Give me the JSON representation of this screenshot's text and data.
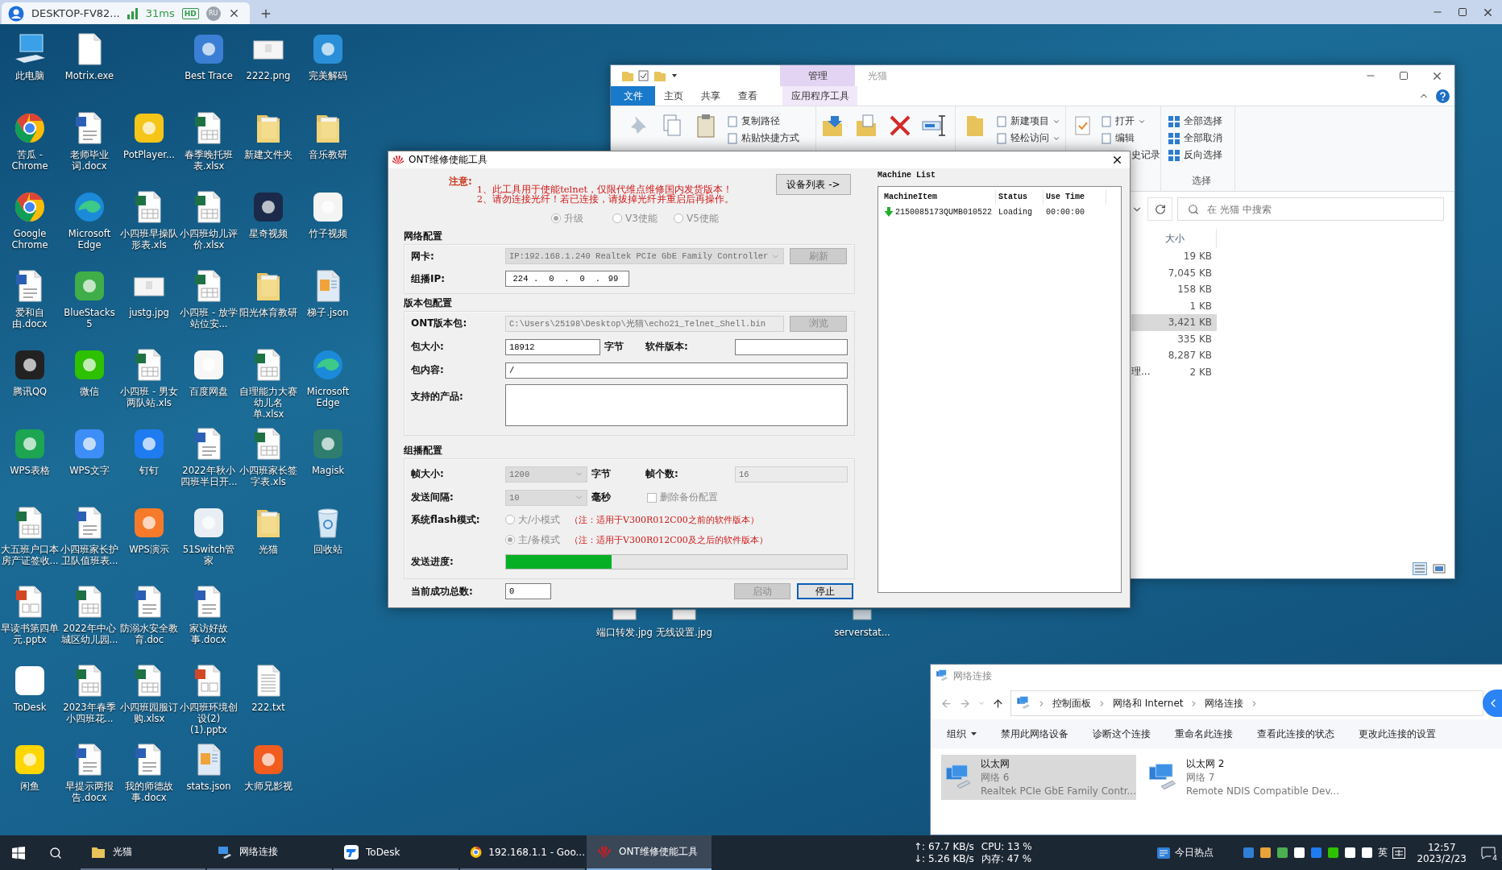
{
  "remote_tab": {
    "title": "DESKTOP-FV82...",
    "latency": "31ms",
    "quality": "HD",
    "user": "RU"
  },
  "desktop_icon_rows": [
    [
      {
        "label": "此电脑",
        "kind": "pc"
      },
      {
        "label": "Motrix.exe",
        "kind": "file"
      },
      null,
      {
        "label": "Best Trace",
        "kind": "app",
        "color": "#3b7fd4"
      },
      {
        "label": "2222.png",
        "kind": "image"
      },
      {
        "label": "完美解码",
        "kind": "app",
        "color": "#2a8fd8"
      }
    ],
    [
      {
        "label": "苦瓜 - Chrome",
        "kind": "chrome"
      },
      {
        "label": "老师毕业词.docx",
        "kind": "word"
      },
      {
        "label": "PotPlayer...",
        "kind": "app",
        "color": "#f5c518"
      },
      {
        "label": "春季晚托班表.xlsx",
        "kind": "excel"
      },
      {
        "label": "新建文件夹",
        "kind": "folder"
      },
      {
        "label": "音乐教研",
        "kind": "folder"
      }
    ],
    [
      {
        "label": "Google Chrome",
        "kind": "chrome"
      },
      {
        "label": "Microsoft Edge",
        "kind": "edge"
      },
      {
        "label": "小四班早操队形表.xls",
        "kind": "excel"
      },
      {
        "label": "小四班幼儿评价.xlsx",
        "kind": "excel"
      },
      {
        "label": "星奇视频",
        "kind": "app",
        "color": "#1b2a4a"
      },
      {
        "label": "竹子视频",
        "kind": "app",
        "color": "#f4f4f4"
      }
    ],
    [
      {
        "label": "爱和自由.docx",
        "kind": "word"
      },
      {
        "label": "BlueStacks 5",
        "kind": "app",
        "color": "#3fae49"
      },
      {
        "label": "justg.jpg",
        "kind": "image"
      },
      {
        "label": "小四班 - 放学站位安...",
        "kind": "excel"
      },
      {
        "label": "阳光体育教研",
        "kind": "folder"
      },
      {
        "label": "梯子.json",
        "kind": "json"
      }
    ],
    [
      {
        "label": "腾讯QQ",
        "kind": "app",
        "color": "#222222"
      },
      {
        "label": "微信",
        "kind": "app",
        "color": "#2dc100"
      },
      {
        "label": "小四班 - 男女两队站.xls",
        "kind": "excel"
      },
      {
        "label": "百度网盘",
        "kind": "app",
        "color": "#f7f7f7"
      },
      {
        "label": "自理能力大赛幼儿名单.xlsx",
        "kind": "excel"
      },
      {
        "label": "Microsoft Edge",
        "kind": "edge"
      }
    ],
    [
      {
        "label": "WPS表格",
        "kind": "app",
        "color": "#1da552"
      },
      {
        "label": "WPS文字",
        "kind": "app",
        "color": "#3d8ef7"
      },
      {
        "label": "钉钉",
        "kind": "app",
        "color": "#1f7cf0"
      },
      {
        "label": "2022年秋小四班半日开...",
        "kind": "word"
      },
      {
        "label": "小四班家长签字表.xls",
        "kind": "excel"
      },
      {
        "label": "Magisk",
        "kind": "app",
        "color": "#2f7d6e"
      }
    ],
    [
      {
        "label": "大五班户口本房产证签收...",
        "kind": "excel"
      },
      {
        "label": "小四班家长护卫队值班表...",
        "kind": "word"
      },
      {
        "label": "WPS演示",
        "kind": "app",
        "color": "#f77a2a"
      },
      {
        "label": "51Switch管家",
        "kind": "app",
        "color": "#e9eef5"
      },
      {
        "label": "光猫",
        "kind": "folder"
      },
      {
        "label": "回收站",
        "kind": "recycle"
      }
    ],
    [
      {
        "label": "早读书第四单元.pptx",
        "kind": "ppt"
      },
      {
        "label": "2022年中心城区幼儿园...",
        "kind": "excel"
      },
      {
        "label": "防溺水安全教育.doc",
        "kind": "word"
      },
      {
        "label": "家访好故事.docx",
        "kind": "word"
      }
    ],
    [
      {
        "label": "ToDesk",
        "kind": "app",
        "color": "#ffffff"
      },
      {
        "label": "2023年春季小四班花...",
        "kind": "excel"
      },
      {
        "label": "小四班园服订购.xlsx",
        "kind": "excel"
      },
      {
        "label": "小四班环境创设(2)(1).pptx",
        "kind": "ppt"
      },
      {
        "label": "222.txt",
        "kind": "text"
      }
    ],
    [
      {
        "label": "闲鱼",
        "kind": "app",
        "color": "#ffd600"
      },
      {
        "label": "早提示两报告.docx",
        "kind": "word"
      },
      {
        "label": "我的师德故事.docx",
        "kind": "word"
      },
      {
        "label": "stats.json",
        "kind": "json"
      },
      {
        "label": "大师兄影视",
        "kind": "app",
        "color": "#f25c1f"
      }
    ]
  ],
  "desktop_extra_icons": [
    {
      "label": "端口转发.jpg",
      "kind": "image"
    },
    {
      "label": "无线设置.jpg",
      "kind": "image"
    },
    {
      "label": "serverstat...",
      "kind": "file"
    }
  ],
  "explorer": {
    "title": "光猫",
    "context_header": "管理",
    "tabs": [
      {
        "label": "文件",
        "kind": "file"
      },
      {
        "label": "主页",
        "kind": "tab"
      },
      {
        "label": "共享",
        "kind": "tab"
      },
      {
        "label": "查看",
        "kind": "tab"
      },
      {
        "label": "应用程序工具",
        "kind": "context"
      }
    ],
    "clipboard_commands": [
      {
        "label": "复制路径",
        "kind": "icon",
        "dropdown": false
      },
      {
        "label": "粘贴快捷方式",
        "kind": "icon",
        "dropdown": false
      }
    ],
    "new_commands": [
      {
        "label": "新建项目",
        "kind": "icon",
        "dropdown": true
      },
      {
        "label": "轻松访问",
        "kind": "icon",
        "dropdown": true
      }
    ],
    "open_commands": [
      {
        "label": "打开",
        "kind": "icon",
        "dropdown": true
      },
      {
        "label": "编辑",
        "kind": "icon",
        "dropdown": false
      },
      {
        "label": "史记录",
        "kind": "cut",
        "dropdown": false
      }
    ],
    "select_commands": [
      {
        "label": "全部选择",
        "kind": "icon",
        "dropdown": false
      },
      {
        "label": "全部取消",
        "kind": "icon",
        "dropdown": false
      },
      {
        "label": "反向选择",
        "kind": "icon",
        "dropdown": false
      }
    ],
    "select_label": "选择",
    "search_placeholder": "在 光猫 中搜索",
    "size_column": "大小",
    "files": [
      {
        "size": "19 KB",
        "selected": false
      },
      {
        "size": "7,045 KB",
        "selected": false
      },
      {
        "size": "158 KB",
        "selected": false
      },
      {
        "size": "1 KB",
        "selected": false
      },
      {
        "size": "3,421 KB",
        "selected": true
      },
      {
        "size": "335 KB",
        "selected": false
      },
      {
        "size": "8,287 KB",
        "selected": false
      },
      {
        "name": "理...",
        "size": "2 KB",
        "selected": false
      }
    ]
  },
  "ont_tool": {
    "title": "ONT维修使能工具",
    "notice_label": "注意:",
    "notice_lines": [
      "1、此工具用于使能telnet，仅限代维点维修国内发货版本！",
      "2、请勿连接光纤！若已连接，请拔掉光纤并重启后再操作。"
    ],
    "device_list_button": "设备列表 ->",
    "modes": [
      {
        "label": "升级",
        "selected": true,
        "disabled": true
      },
      {
        "label": "V3使能",
        "selected": false,
        "disabled": true
      },
      {
        "label": "V5使能",
        "selected": false,
        "disabled": true
      }
    ],
    "network": {
      "title": "网络配置",
      "nic_label": "网卡:",
      "nic_value": "IP:192.168.1.240 Realtek PCIe GbE Family Controller",
      "refresh_button": {
        "label": "刷新",
        "disabled": true
      },
      "ip_label": "组播IP:",
      "ip_parts": [
        "224",
        "0",
        "0",
        "99"
      ],
      "ip_separator": "."
    },
    "package": {
      "title": "版本包配置",
      "file_label": "ONT版本包:",
      "file_value": "C:\\Users\\25198\\Desktop\\光猫\\echo21_Telnet_Shell.bin",
      "browse_button": {
        "label": "浏览",
        "disabled": true
      },
      "size_label": "包大小:",
      "size_value": "18912",
      "size_unit": "字节",
      "version_label": "软件版本:",
      "content_label": "包内容:",
      "content_value": "/",
      "products_label": "支持的产品:"
    },
    "multicast": {
      "title": "组播配置",
      "frame_size_label": "帧大小:",
      "frame_size": "1200",
      "frame_size_unit": "字节",
      "frame_count_label": "帧个数:",
      "frame_count": "16",
      "interval_label": "发送间隔:",
      "interval": "10",
      "interval_unit": "毫秒",
      "delete_backup": {
        "label": "删除备份配置",
        "checked": false
      },
      "flash_label": "系统flash模式:",
      "flash_modes": [
        {
          "label": "大/小模式",
          "note": "（注：适用于V300R012C00之前的软件版本）",
          "selected": false
        },
        {
          "label": "主/备模式",
          "note": "（注：适用于V300R012C00及之后的软件版本）",
          "selected": true
        }
      ],
      "progress_label": "发送进度:",
      "progress": {
        "level": 0.31
      }
    },
    "success_label": "当前成功总数:",
    "success_count": "0",
    "start_button": {
      "label": "启动",
      "disabled": true
    },
    "stop_button": {
      "label": "停止",
      "disabled": false
    },
    "machine_list": {
      "title": "Machine List",
      "columns": [
        "MachineItem",
        "Status",
        "Use Time"
      ],
      "rows": [
        {
          "cells": [
            "2150085173QUMB010522",
            "Loading",
            "00:00:00"
          ]
        }
      ]
    }
  },
  "network_window": {
    "title": "网络连接",
    "breadcrumbs": [
      "控制面板",
      "网络和 Internet",
      "网络连接"
    ],
    "commands": [
      {
        "label": "组织",
        "dropdown": true
      },
      {
        "label": "禁用此网络设备",
        "dropdown": false
      },
      {
        "label": "诊断这个连接",
        "dropdown": false
      },
      {
        "label": "重命名此连接",
        "dropdown": false
      },
      {
        "label": "查看此连接的状态",
        "dropdown": false
      },
      {
        "label": "更改此连接的设置",
        "dropdown": false
      }
    ],
    "connections": [
      {
        "name": "以太网",
        "network": "网络 6",
        "device": "Realtek PCIe GbE Family Contr...",
        "selected": true
      },
      {
        "name": "以太网 2",
        "network": "网络 7",
        "device": "Remote NDIS Compatible Dev...",
        "selected": false
      }
    ]
  },
  "taskbar": {
    "items": [
      {
        "label": "光猫",
        "kind": "folder",
        "active": false
      },
      {
        "label": "网络连接",
        "kind": "network",
        "active": false
      },
      {
        "label": "ToDesk",
        "kind": "remote",
        "active": false
      },
      {
        "label": "192.168.1.1 - Goo...",
        "kind": "browser",
        "active": false
      },
      {
        "label": "ONT维修使能工具",
        "kind": "tool",
        "active": true
      }
    ],
    "net_up": "↑: 67.7 KB/s",
    "net_down": "↓: 5.26 KB/s",
    "cpu": "CPU: 13 %",
    "memory": "内存: 47 %",
    "news": "今日热点",
    "ime": "英",
    "time": "12:57",
    "date": "2023/2/23",
    "notifications": "4"
  }
}
